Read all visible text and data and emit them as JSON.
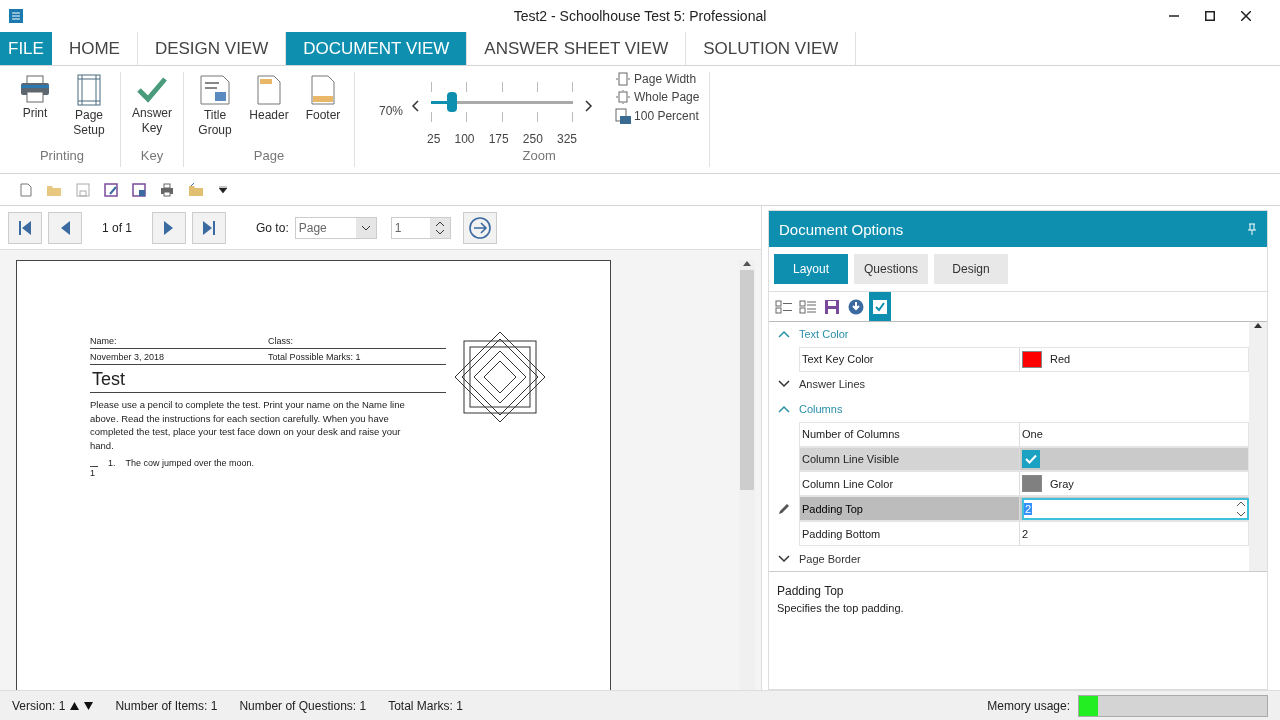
{
  "window": {
    "title": "Test2 - Schoolhouse Test 5: Professional"
  },
  "ribbon_tabs": [
    {
      "label": "FILE",
      "kind": "file",
      "selected": false
    },
    {
      "label": "HOME",
      "kind": "tab",
      "selected": false
    },
    {
      "label": "DESIGN VIEW",
      "kind": "tab",
      "selected": false
    },
    {
      "label": "DOCUMENT VIEW",
      "kind": "tab",
      "selected": true
    },
    {
      "label": "ANSWER SHEET VIEW",
      "kind": "tab",
      "selected": false
    },
    {
      "label": "SOLUTION VIEW",
      "kind": "tab",
      "selected": false
    }
  ],
  "ribbon_groups": [
    {
      "label": "Printing",
      "buttons": [
        {
          "label": "Print",
          "kind": "print"
        },
        {
          "label": "Page Setup",
          "kind": "setup"
        }
      ]
    },
    {
      "label": "Key",
      "buttons": [
        {
          "label": "Answer Key",
          "kind": "check"
        }
      ]
    },
    {
      "label": "Page",
      "buttons": [
        {
          "label": "Title Group",
          "kind": "title"
        },
        {
          "label": "Header",
          "kind": "header"
        },
        {
          "label": "Footer",
          "kind": "footer"
        }
      ]
    }
  ],
  "zoom": {
    "label": "Zoom",
    "reading": "70%",
    "level": 0.15,
    "ticks": [
      "25",
      "100",
      "175",
      "250",
      "325"
    ],
    "options": [
      {
        "label": "Page Width",
        "kind": "width"
      },
      {
        "label": "Whole Page",
        "kind": "whole"
      },
      {
        "label": "100 Percent",
        "kind": "percent"
      }
    ]
  },
  "navigator": {
    "page": "1 of 1",
    "goto_label": "Go to:",
    "goto_type": "Page",
    "goto_value": "1"
  },
  "document": {
    "name_label": "Name:",
    "class_label": "Class:",
    "date": "November 3, 2018",
    "total": "Total Possible Marks: 1",
    "title": "Test",
    "instructions": "Please use a pencil to complete the test. Print your name on the Name line above. Read the instructions for each section carefully. When you have completed the test, place your test face down on your desk and raise your hand.",
    "questions": [
      {
        "number": "1.",
        "text": "The cow jumped over the moon.",
        "marks": "1"
      }
    ]
  },
  "panel": {
    "title": "Document Options",
    "tabs": [
      {
        "label": "Layout",
        "selected": true
      },
      {
        "label": "Questions",
        "selected": false
      },
      {
        "label": "Design",
        "selected": false
      }
    ],
    "toolbar": [
      {
        "kind": "categorized",
        "on": false
      },
      {
        "kind": "alphabetical",
        "on": false
      },
      {
        "kind": "save",
        "on": false
      },
      {
        "kind": "load",
        "on": false
      },
      {
        "kind": "check",
        "on": true
      }
    ],
    "categories": [
      {
        "label": "Text Color",
        "expanded": true,
        "properties": [
          {
            "name": "Text Key Color",
            "kind": "color",
            "value": "Red",
            "color": "#ff0000",
            "hovered": false,
            "selected": false
          }
        ]
      },
      {
        "label": "Answer Lines",
        "expanded": false
      },
      {
        "label": "Columns",
        "expanded": true,
        "properties": [
          {
            "name": "Number of Columns",
            "kind": "text",
            "value": "One",
            "hovered": false,
            "selected": false
          },
          {
            "name": "Column Line Visible",
            "kind": "check",
            "checked": true,
            "hovered": true,
            "selected": false
          },
          {
            "name": "Column Line Color",
            "kind": "color",
            "value": "Gray",
            "color": "#808080",
            "hovered": false,
            "selected": false
          },
          {
            "name": "Padding Top",
            "kind": "spin",
            "value": "2",
            "hovered": false,
            "selected": true
          },
          {
            "name": "Padding Bottom",
            "kind": "text",
            "value": "2",
            "hovered": false,
            "selected": false
          }
        ]
      },
      {
        "label": "Page Border",
        "expanded": false
      }
    ],
    "description": {
      "title": "Padding Top",
      "text": "Specifies the top padding."
    }
  },
  "status_bar": {
    "version": "Version: 1",
    "items": "Number of Items: 1",
    "questions": "Number of Questions: 1",
    "marks": "Total Marks: 1",
    "memory": {
      "label": "Memory usage:",
      "level": 0.1
    }
  }
}
